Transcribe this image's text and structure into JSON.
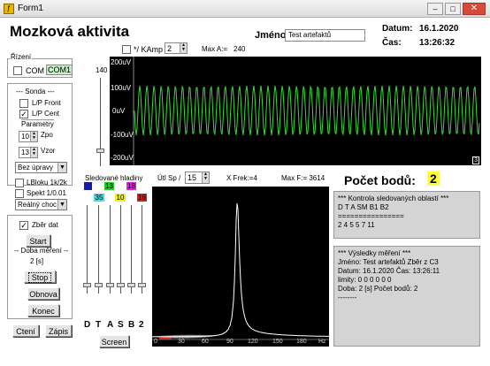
{
  "window": {
    "title": "Form1"
  },
  "header": {
    "app_title": "Mozková aktivita",
    "name_label": "Jméno:",
    "name_value": "Test artefaktů",
    "date_label": "Datum:",
    "date_value": "16.1.2020",
    "time_label": "Čas:",
    "time_value": "13:26:32"
  },
  "top_controls": {
    "kamp_label": "*/ KAmp",
    "kamp_value": "2",
    "max_a_label": "Max A:=",
    "max_a_value": "240"
  },
  "sidebar": {
    "rizeni_label": "Řízení",
    "com_label": "COM",
    "com_value": "COM1",
    "sonda_label": "--- Sonda ---",
    "lp_front_label": "L/P Front",
    "lp_cent_label": "L/P Cent",
    "lp_cent_checked": true,
    "parametry_label": "Parametry",
    "zpo_value": "10",
    "zpo_label": "Zpo",
    "vzor_value": "13",
    "vzor_label": "Vzor",
    "filter_value": "Bez úpravy",
    "lbloku_label": "LBloku 1k/2k",
    "spekt_label": "Spekt 1/0.01",
    "mode_value": "Reálný choc",
    "zber_label": "Zběr dat",
    "zber_checked": true,
    "start_label": "Start",
    "doba_label": "-- Doba měření --",
    "doba_value": "2 [s]",
    "stop_label": "Stop",
    "obnova_label": "Obnova",
    "konec_label": "Konec",
    "cteni_label": "Ctení",
    "zapis_label": "Zápis"
  },
  "eeg_plot": {
    "y_axis_value": "140",
    "y_labels": [
      "200uV",
      "100uV",
      "0uV",
      "-100uV",
      "-200uV"
    ],
    "corner_label": "3",
    "signal_color": "#33dd33"
  },
  "spectrum_controls": {
    "sledovane_label": "Sledované hladiny",
    "utl_label": "Útl Sp /",
    "utl_value": "15",
    "frek_label": "X Frek:=4",
    "maxf_label": "Max F:= 3614",
    "level_values": [
      "13",
      "18",
      "35",
      "10",
      "16"
    ],
    "band_letters": [
      "D",
      "T",
      "A",
      "S",
      "B",
      "2"
    ],
    "screen_label": "Screen",
    "x_ticks": [
      "0",
      "30",
      "60",
      "90",
      "120",
      "150",
      "180",
      "Hz"
    ]
  },
  "pocet": {
    "label": "Počet bodů:",
    "value": "2"
  },
  "kontrola_panel": {
    "title": "*** Kontrola sledovaných oblastí ***",
    "header": "D   T   A   SM   B1   B2",
    "divider": "================",
    "values": "2   4   5   5   7   11"
  },
  "vysledky_panel": {
    "title": "*** Výsledky měření ***",
    "line1": "Jméno: Test artefaktů   Zběr z C3",
    "line2": "Datum: 16.1.2020  Čas: 13:26:11",
    "line3": "limity:  0   0   0   0   0   0",
    "line4": "Doba: 2 [s]   Počet bodů: 2",
    "line5": "--------"
  },
  "colors": {
    "blue": "#1a1aa0",
    "green": "#22cc22",
    "magenta": "#dd22dd",
    "cyan": "#44dddd",
    "yellow": "#eeee22",
    "red": "#cc2222",
    "pocet_bg": "#ffff33"
  }
}
